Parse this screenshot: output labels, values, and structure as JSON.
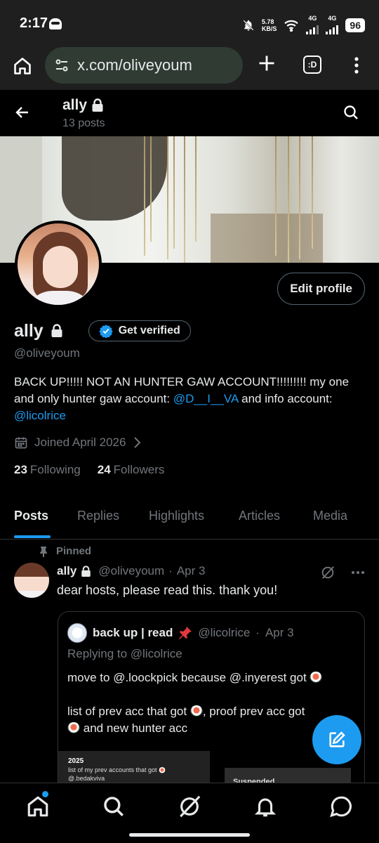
{
  "status_bar": {
    "time": "2:17",
    "net_speed_value": "5.78",
    "net_speed_unit": "KB/S",
    "sim1": "4G",
    "sim2": "4G",
    "battery": "96"
  },
  "browser": {
    "url": "x.com/oliveyoum",
    "tabs_label": ":D"
  },
  "header": {
    "title": "ally",
    "posts_count": "13 posts"
  },
  "profile": {
    "name": "ally",
    "handle": "@oliveyoum",
    "edit_label": "Edit profile",
    "get_verified_label": "Get verified",
    "bio_text_1": "BACK UP!!!!! NOT AN HUNTER GAW ACCOUNT!!!!!!!!! my one and only hunter gaw account: ",
    "bio_link_1": "@D__I__VA",
    "bio_text_2": " and info account: ",
    "bio_link_2": "@licolrice",
    "joined": "Joined April 2026",
    "following_count": "23",
    "following_label": "Following",
    "followers_count": "24",
    "followers_label": "Followers"
  },
  "tabs": [
    {
      "label": "Posts",
      "active": true
    },
    {
      "label": "Replies"
    },
    {
      "label": "Highlights"
    },
    {
      "label": "Articles"
    },
    {
      "label": "Media"
    }
  ],
  "post": {
    "pinned_label": "Pinned",
    "name": "ally",
    "handle": "@oliveyoum",
    "separator": "·",
    "date": "Apr 3",
    "text": "dear hosts, please read this. thank you!",
    "quote": {
      "name": "back up | read",
      "handle": "@licolrice",
      "separator": "·",
      "date": "Apr 3",
      "replying": "Replying to @licolrice",
      "line1": "move to @.loockpick because @.inyerest got",
      "line2a": "list of prev acc that got",
      "line2b": ", proof prev acc got",
      "line3": "and new hunter acc",
      "image1_title": "2025",
      "image1_line1": "list of my prev accounts that got",
      "image1_line2": "@.bedakviva",
      "image2_text": "Suspended"
    }
  },
  "colors": {
    "accent": "#1d9bf0",
    "text": "#e7e9ea",
    "muted": "#71767b",
    "border": "#2f3336",
    "background": "#000000"
  }
}
